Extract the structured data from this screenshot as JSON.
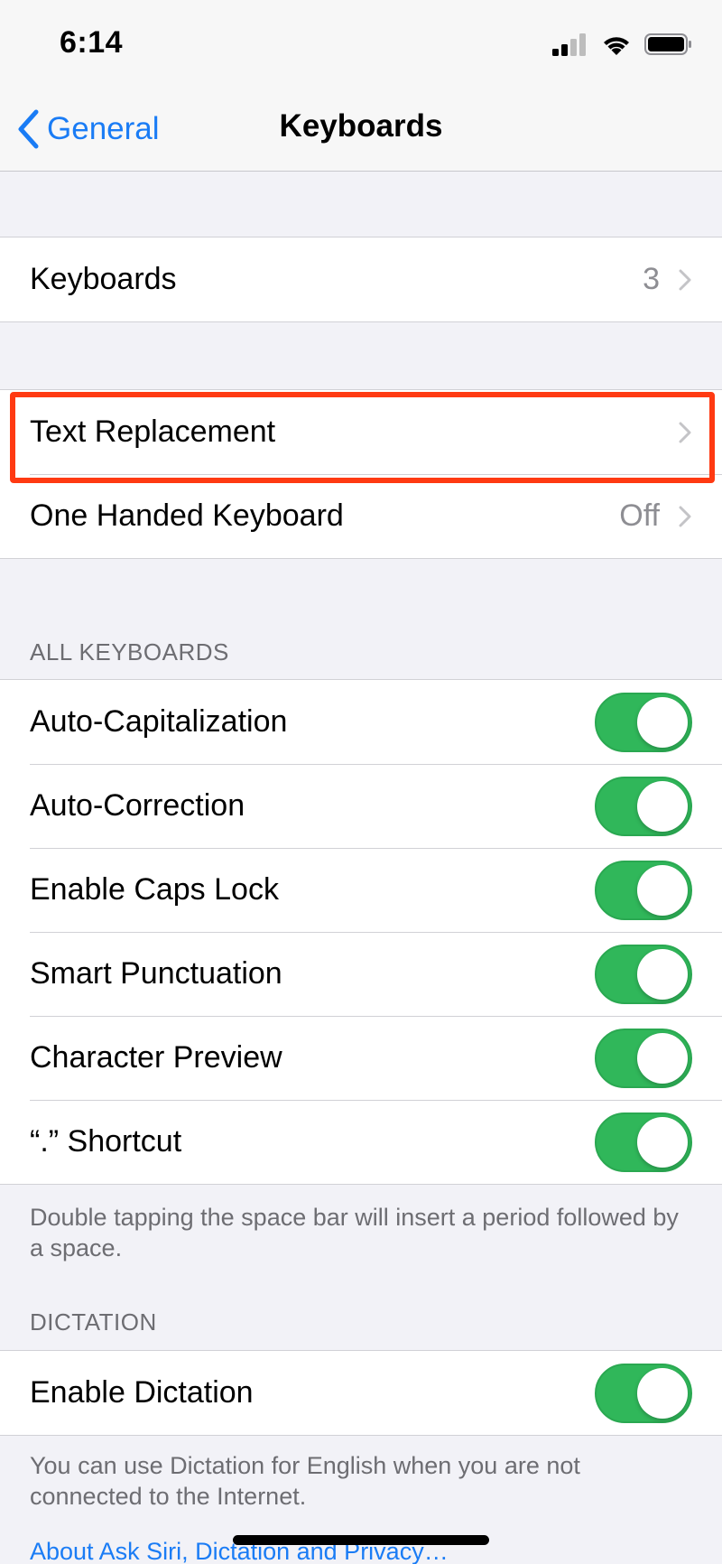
{
  "status": {
    "time": "6:14"
  },
  "nav": {
    "back_label": "General",
    "title": "Keyboards"
  },
  "keyboards_row": {
    "label": "Keyboards",
    "value": "3"
  },
  "text_rows": [
    {
      "label": "Text Replacement",
      "value": ""
    },
    {
      "label": "One Handed Keyboard",
      "value": "Off"
    }
  ],
  "all_keyboards": {
    "header": "ALL KEYBOARDS",
    "toggles": [
      {
        "label": "Auto-Capitalization",
        "on": true
      },
      {
        "label": "Auto-Correction",
        "on": true
      },
      {
        "label": "Enable Caps Lock",
        "on": true
      },
      {
        "label": "Smart Punctuation",
        "on": true
      },
      {
        "label": "Character Preview",
        "on": true
      },
      {
        "label": "“.” Shortcut",
        "on": true
      }
    ],
    "footer": "Double tapping the space bar will insert a period followed by a space."
  },
  "dictation": {
    "header": "DICTATION",
    "toggle": {
      "label": "Enable Dictation",
      "on": true
    },
    "footer": "You can use Dictation for English when you are not connected to the Internet.",
    "link": "About Ask Siri, Dictation and Privacy…"
  },
  "colors": {
    "accent": "#1a7cf5",
    "toggle_on": "#30b75a",
    "highlight": "#ff3a12"
  }
}
